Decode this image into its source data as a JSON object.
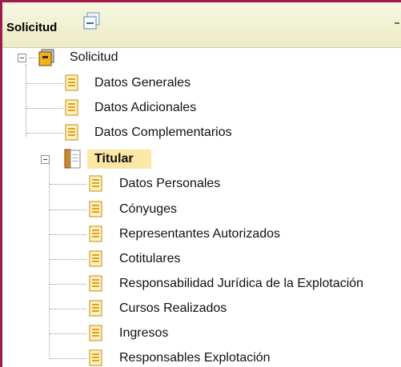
{
  "panel": {
    "title": "Solicitud"
  },
  "tree": {
    "root": {
      "label": "Solicitud"
    },
    "level1": [
      {
        "label": "Datos Generales"
      },
      {
        "label": "Datos Adicionales"
      },
      {
        "label": "Datos Complementarios"
      }
    ],
    "titular": {
      "label": "Titular",
      "selected": true
    },
    "titular_children": [
      {
        "label": "Datos Personales"
      },
      {
        "label": "Cónyuges"
      },
      {
        "label": "Representantes Autorizados"
      },
      {
        "label": "Cotitulares"
      },
      {
        "label": "Responsabilidad Jurídica de la Explotación"
      },
      {
        "label": "Cursos Realizados"
      },
      {
        "label": "Ingresos"
      },
      {
        "label": "Responsables Explotación"
      }
    ]
  },
  "colors": {
    "border": "#a11b4a",
    "header_bg": "#f3f3d7",
    "selection": "#fde7a4",
    "doc_icon": "#f1b32e"
  }
}
